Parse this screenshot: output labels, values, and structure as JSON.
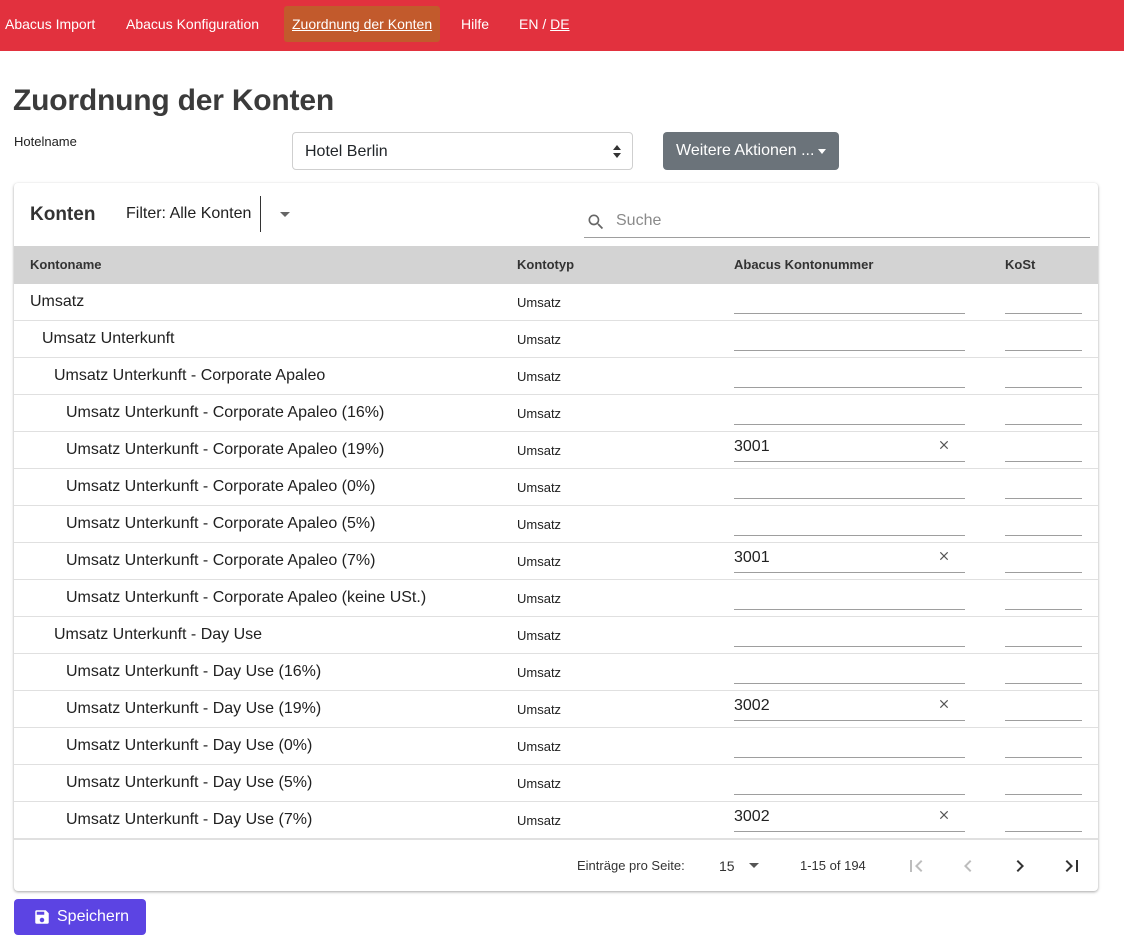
{
  "nav": {
    "items": [
      "Abacus Import",
      "Abacus Konfiguration",
      "Zuordnung der Konten",
      "Hilfe"
    ],
    "lang_en": "EN",
    "lang_sep": "/",
    "lang_de": "DE"
  },
  "page": {
    "title": "Zuordnung der Konten",
    "hotel_label": "Hotelname",
    "hotel_value": "Hotel Berlin",
    "more_actions": "Weitere Aktionen ..."
  },
  "card": {
    "title": "Konten",
    "filter": "Filter: Alle Konten",
    "search_placeholder": "Suche"
  },
  "table": {
    "columns": [
      "Kontoname",
      "Kontotyp",
      "Abacus Kontonummer",
      "KoSt"
    ],
    "rows": [
      {
        "name": "Umsatz",
        "level": 0,
        "type": "Umsatz",
        "account": "",
        "kost": ""
      },
      {
        "name": "Umsatz Unterkunft",
        "level": 1,
        "type": "Umsatz",
        "account": "",
        "kost": ""
      },
      {
        "name": "Umsatz Unterkunft - Corporate Apaleo",
        "level": 2,
        "type": "Umsatz",
        "account": "",
        "kost": ""
      },
      {
        "name": "Umsatz Unterkunft - Corporate Apaleo (16%)",
        "level": 3,
        "type": "Umsatz",
        "account": "",
        "kost": ""
      },
      {
        "name": "Umsatz Unterkunft - Corporate Apaleo (19%)",
        "level": 3,
        "type": "Umsatz",
        "account": "3001",
        "kost": ""
      },
      {
        "name": "Umsatz Unterkunft - Corporate Apaleo (0%)",
        "level": 3,
        "type": "Umsatz",
        "account": "",
        "kost": ""
      },
      {
        "name": "Umsatz Unterkunft - Corporate Apaleo (5%)",
        "level": 3,
        "type": "Umsatz",
        "account": "",
        "kost": ""
      },
      {
        "name": "Umsatz Unterkunft - Corporate Apaleo (7%)",
        "level": 3,
        "type": "Umsatz",
        "account": "3001",
        "kost": ""
      },
      {
        "name": "Umsatz Unterkunft - Corporate Apaleo (keine USt.)",
        "level": 3,
        "type": "Umsatz",
        "account": "",
        "kost": ""
      },
      {
        "name": "Umsatz Unterkunft - Day Use",
        "level": 2,
        "type": "Umsatz",
        "account": "",
        "kost": ""
      },
      {
        "name": "Umsatz Unterkunft - Day Use (16%)",
        "level": 3,
        "type": "Umsatz",
        "account": "",
        "kost": ""
      },
      {
        "name": "Umsatz Unterkunft - Day Use (19%)",
        "level": 3,
        "type": "Umsatz",
        "account": "3002",
        "kost": ""
      },
      {
        "name": "Umsatz Unterkunft - Day Use (0%)",
        "level": 3,
        "type": "Umsatz",
        "account": "",
        "kost": ""
      },
      {
        "name": "Umsatz Unterkunft - Day Use (5%)",
        "level": 3,
        "type": "Umsatz",
        "account": "",
        "kost": ""
      },
      {
        "name": "Umsatz Unterkunft - Day Use (7%)",
        "level": 3,
        "type": "Umsatz",
        "account": "3002",
        "kost": ""
      }
    ]
  },
  "pagination": {
    "per_page_label": "Einträge pro Seite:",
    "per_page": "15",
    "range": "1-15 of 194"
  },
  "save_label": "Speichern",
  "colors": {
    "nav_bg": "#e2313e",
    "nav_active_bg": "#c25a2c",
    "primary": "#5c44e3",
    "secondary_btn": "#6b737a",
    "table_header_bg": "#d3d3d3"
  },
  "icons": [
    "search-icon",
    "close-icon",
    "chevron-down-icon",
    "first-page-icon",
    "previous-page-icon",
    "next-page-icon",
    "last-page-icon",
    "save-icon"
  ]
}
